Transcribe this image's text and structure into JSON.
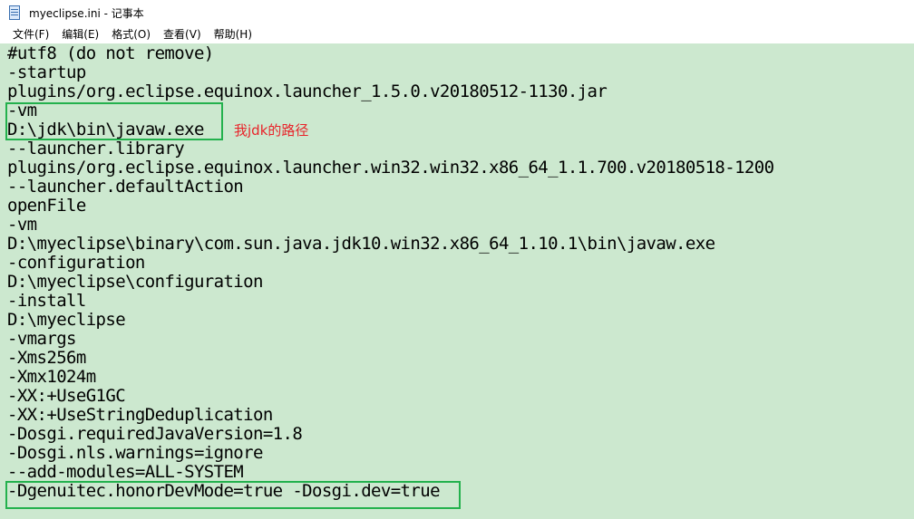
{
  "window": {
    "title": "myeclipse.ini - 记事本",
    "icon": "notepad-icon"
  },
  "menu": {
    "items": [
      "文件(F)",
      "编辑(E)",
      "格式(O)",
      "查看(V)",
      "帮助(H)"
    ]
  },
  "editor": {
    "background": "#cce8cf",
    "lines": [
      "#utf8 (do not remove)",
      "-startup",
      "plugins/org.eclipse.equinox.launcher_1.5.0.v20180512-1130.jar",
      "-vm",
      "D:\\jdk\\bin\\javaw.exe",
      "--launcher.library",
      "plugins/org.eclipse.equinox.launcher.win32.win32.x86_64_1.1.700.v20180518-1200",
      "--launcher.defaultAction",
      "openFile",
      "-vm",
      "D:\\myeclipse\\binary\\com.sun.java.jdk10.win32.x86_64_1.10.1\\bin\\javaw.exe",
      "-configuration",
      "D:\\myeclipse\\configuration",
      "-install",
      "D:\\myeclipse",
      "-vmargs",
      "-Xms256m",
      "-Xmx1024m",
      "-XX:+UseG1GC",
      "-XX:+UseStringDeduplication",
      "-Dosgi.requiredJavaVersion=1.8",
      "-Dosgi.nls.warnings=ignore",
      "--add-modules=ALL-SYSTEM",
      "-Dgenuitec.honorDevMode=true -Dosgi.dev=true"
    ]
  },
  "annotation": {
    "text": "我jdk的路径",
    "color": "#e8242a",
    "box_color": "#23b14d"
  }
}
